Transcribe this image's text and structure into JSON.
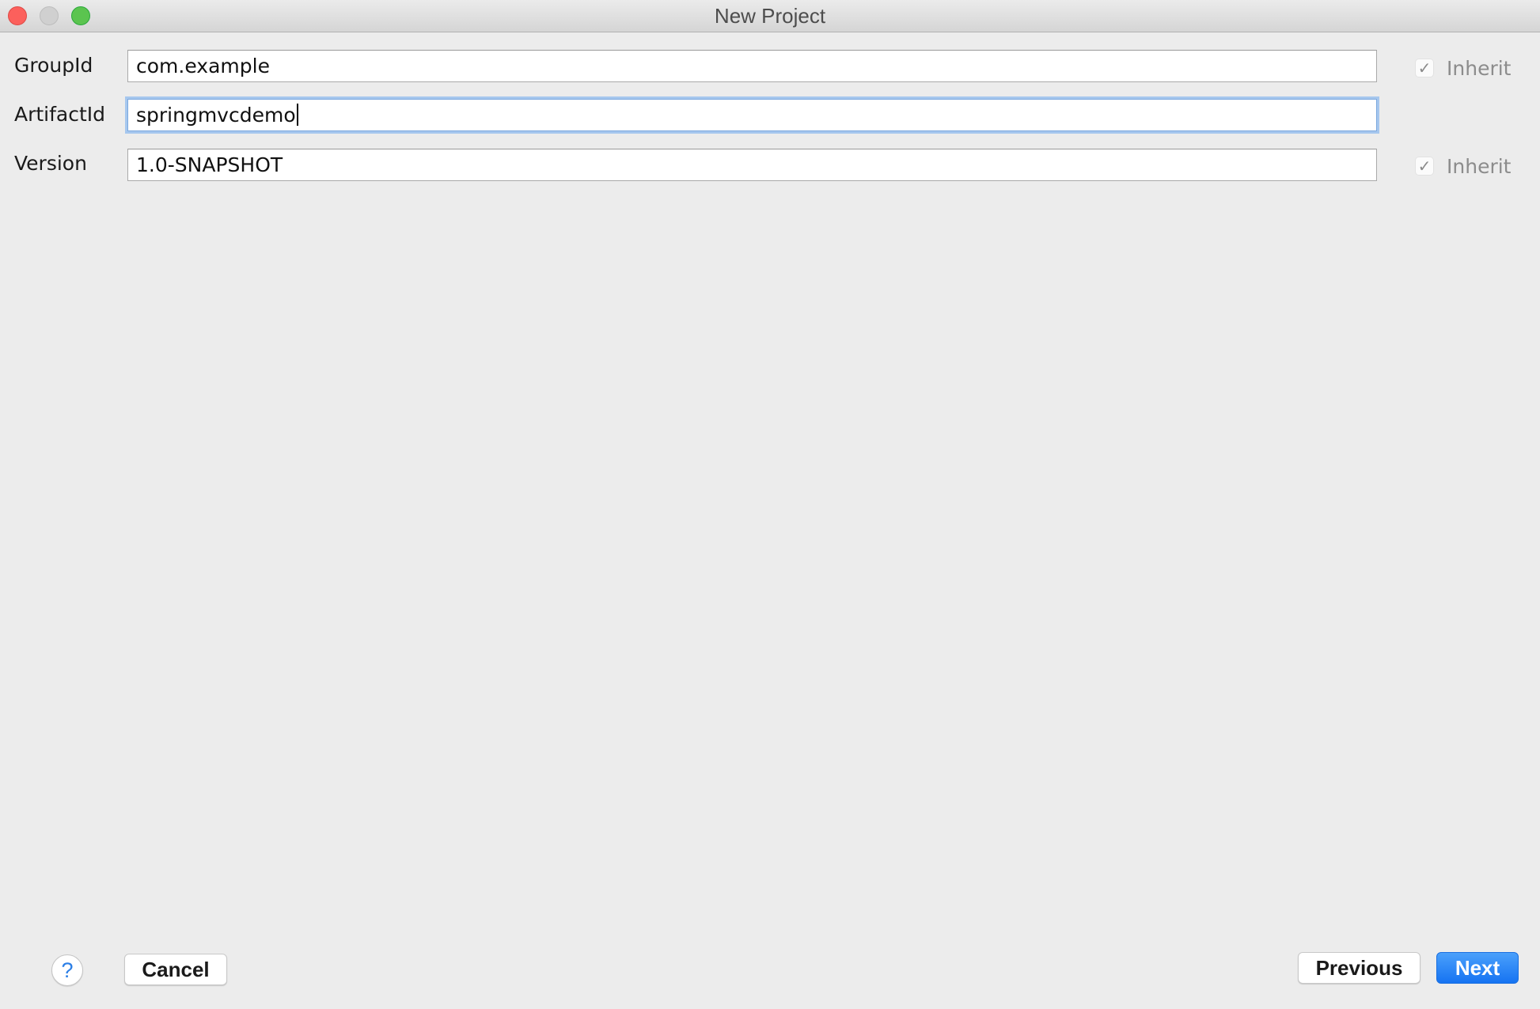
{
  "window": {
    "title": "New Project",
    "controls": [
      "close",
      "minimize",
      "maximize"
    ]
  },
  "form": {
    "group_id": {
      "label": "GroupId",
      "value": "com.example",
      "inherit": {
        "label": "Inherit",
        "checked": true,
        "check_glyph": "✓"
      }
    },
    "artifact_id": {
      "label": "ArtifactId",
      "value": "springmvcdemo",
      "focused": true
    },
    "version": {
      "label": "Version",
      "value": "1.0-SNAPSHOT",
      "inherit": {
        "label": "Inherit",
        "checked": true,
        "check_glyph": "✓"
      }
    }
  },
  "footer": {
    "help_glyph": "?",
    "cancel_label": "Cancel",
    "previous_label": "Previous",
    "next_label": "Next"
  },
  "colors": {
    "accent": "#1673f2",
    "focus_ring": "#a6c7ee",
    "background": "#ececec"
  }
}
